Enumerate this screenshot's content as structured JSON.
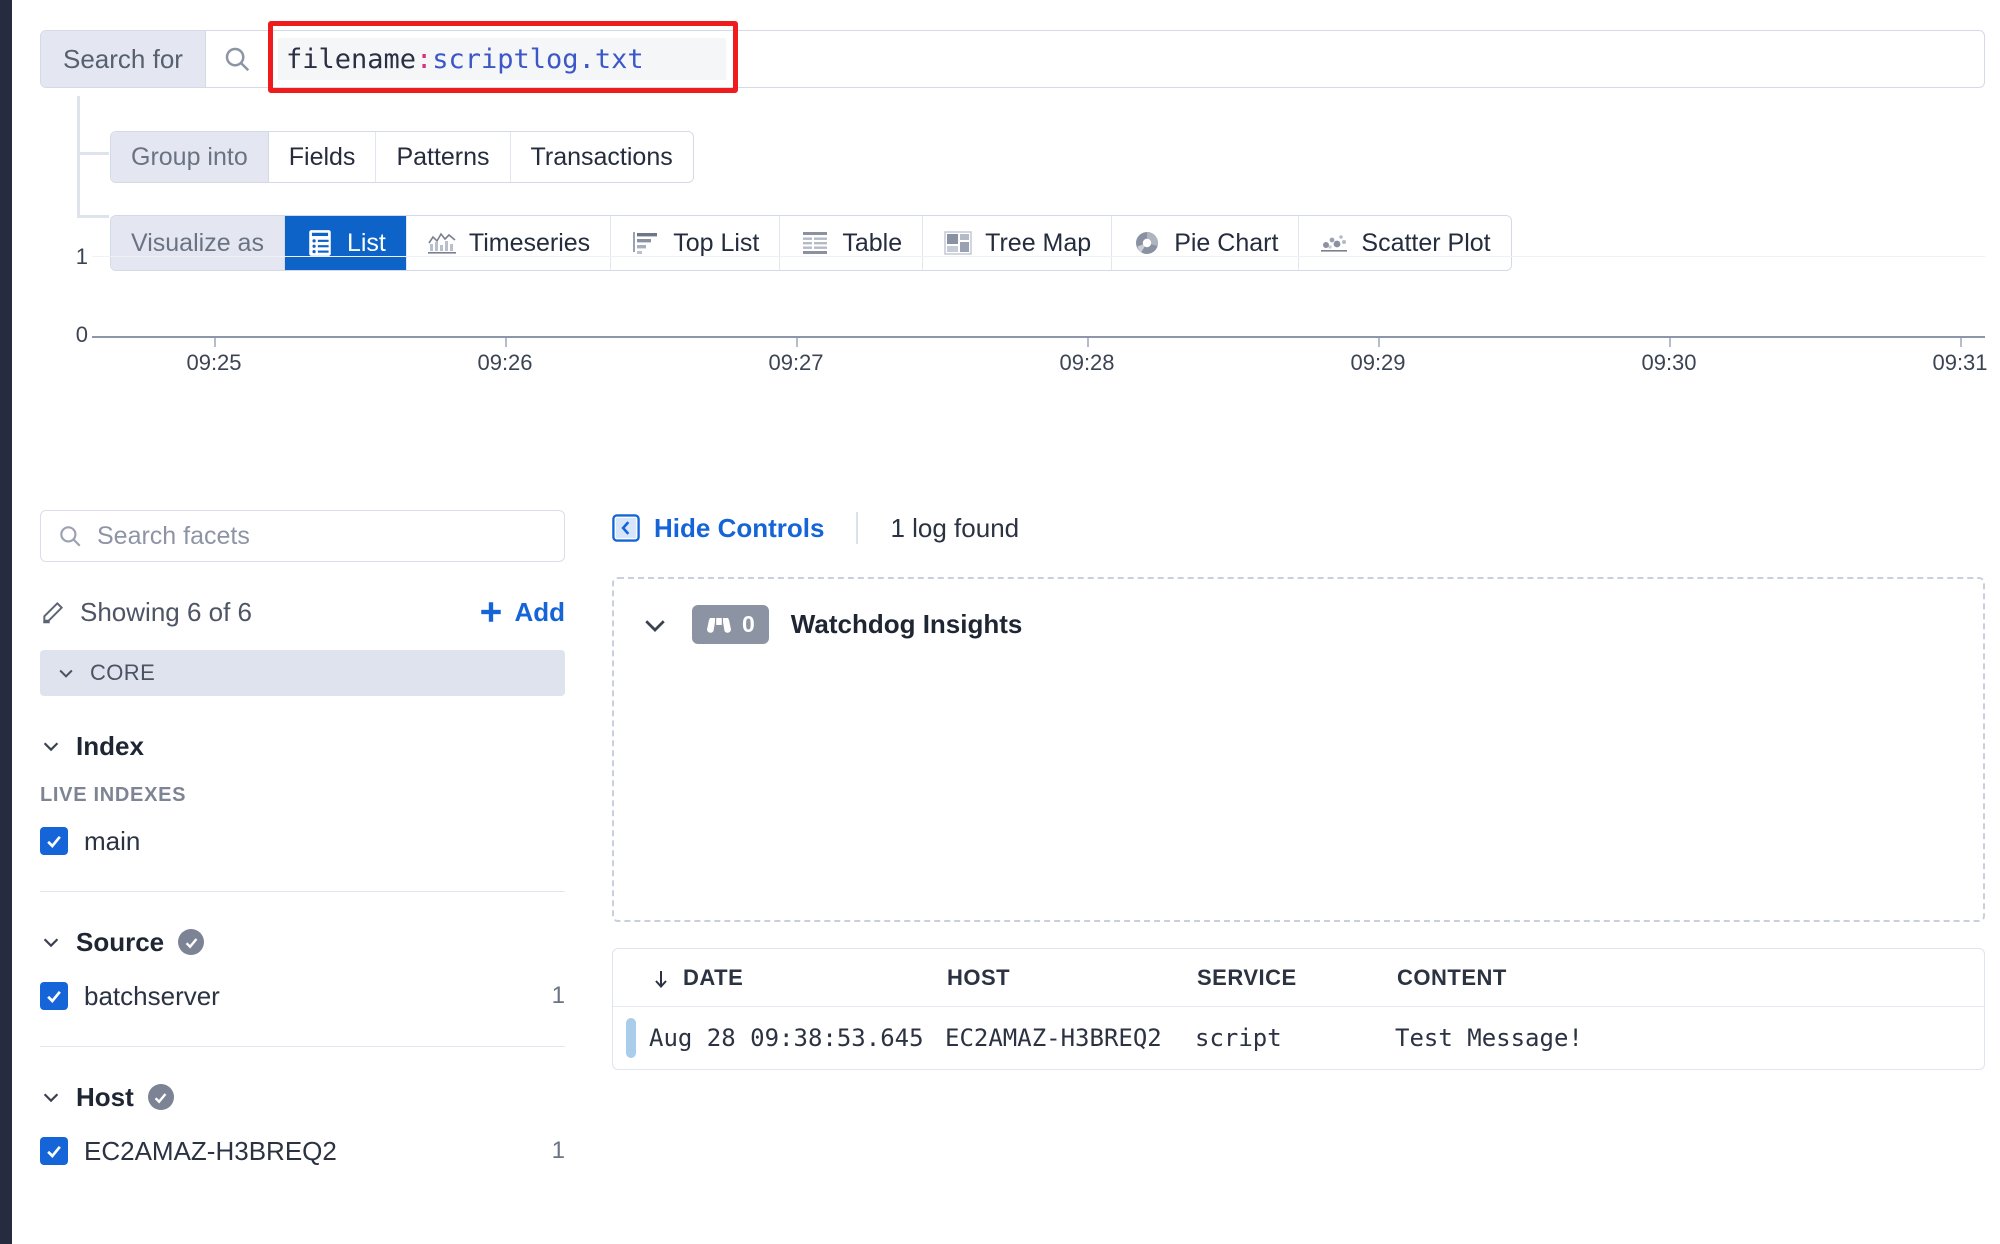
{
  "search": {
    "label": "Search for",
    "icon": "search-icon",
    "query_key": "filename",
    "query_sep": ":",
    "query_value": "scriptlog.txt",
    "highlight_color": "#ee1c1c"
  },
  "group_into": {
    "label": "Group into",
    "options": [
      "Fields",
      "Patterns",
      "Transactions"
    ]
  },
  "visualize_as": {
    "label": "Visualize as",
    "selected": "List",
    "options": [
      {
        "label": "List",
        "icon": "list-icon"
      },
      {
        "label": "Timeseries",
        "icon": "timeseries-icon"
      },
      {
        "label": "Top List",
        "icon": "top-list-icon"
      },
      {
        "label": "Table",
        "icon": "table-icon"
      },
      {
        "label": "Tree Map",
        "icon": "tree-map-icon"
      },
      {
        "label": "Pie Chart",
        "icon": "pie-chart-icon"
      },
      {
        "label": "Scatter Plot",
        "icon": "scatter-plot-icon"
      }
    ]
  },
  "chart_data": {
    "type": "bar",
    "title": "",
    "xlabel": "",
    "ylabel": "",
    "categories": [
      "09:25",
      "09:26",
      "09:27",
      "09:28",
      "09:29",
      "09:30",
      "09:31"
    ],
    "values": [
      0,
      0,
      0,
      0,
      0,
      0,
      0
    ],
    "ytick_labels": [
      "0",
      "1"
    ],
    "ylim": [
      0,
      1
    ],
    "grid": true,
    "legend": "none"
  },
  "facets": {
    "search_placeholder": "Search facets",
    "search_icon": "search-icon",
    "showing_text": "Showing 6 of 6",
    "showing_icon": "pencil-icon",
    "add_label": "Add",
    "add_icon": "plus-icon",
    "core_label": "CORE",
    "groups": [
      {
        "title": "Index",
        "verified": false,
        "sub_label": "LIVE INDEXES",
        "rows": [
          {
            "name": "main",
            "count": "",
            "checked": true
          }
        ]
      },
      {
        "title": "Source",
        "verified": true,
        "sub_label": "",
        "rows": [
          {
            "name": "batchserver",
            "count": "1",
            "checked": true
          }
        ]
      },
      {
        "title": "Host",
        "verified": true,
        "sub_label": "",
        "rows": [
          {
            "name": "EC2AMAZ-H3BREQ2",
            "count": "1",
            "checked": true
          }
        ]
      }
    ]
  },
  "content": {
    "hide_controls_label": "Hide Controls",
    "hide_controls_icon": "collapse-left-icon",
    "log_found_text": "1 log found",
    "watchdog": {
      "title": "Watchdog Insights",
      "count": "0",
      "badge_icon": "binoculars-icon",
      "chevron_icon": "chevron-down-icon"
    },
    "table": {
      "columns": [
        "DATE",
        "HOST",
        "SERVICE",
        "CONTENT"
      ],
      "sort_icon": "arrow-down-icon",
      "rows": [
        {
          "date": "Aug 28 09:38:53.645",
          "host": "EC2AMAZ-H3BREQ2",
          "service": "script",
          "content": "Test Message!"
        }
      ]
    }
  },
  "colors": {
    "accent_blue": "#1565d8",
    "selected_tab": "#0d63c8",
    "highlight_red": "#ee1c1c",
    "row_accent": "#a9cdeb"
  }
}
